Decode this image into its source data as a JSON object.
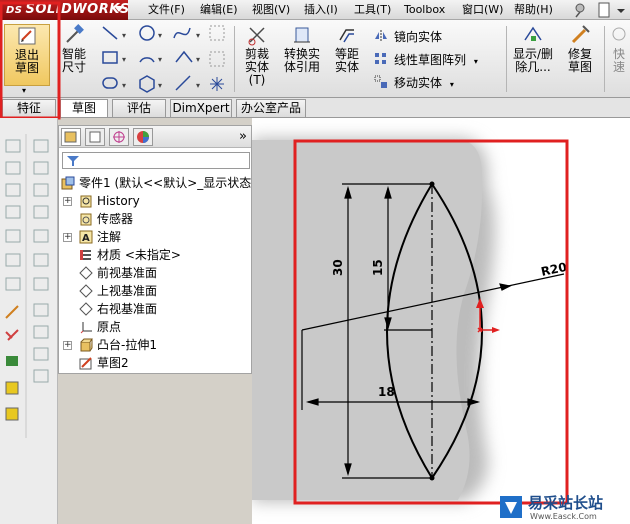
{
  "app": {
    "logo": "SOLIDWORKS",
    "logo_prefix": "DS"
  },
  "menu": [
    "文件(F)",
    "编辑(E)",
    "视图(V)",
    "插入(I)",
    "工具(T)",
    "Toolbox",
    "窗口(W)",
    "帮助(H)"
  ],
  "commands": {
    "exit_sketch": "退出草图",
    "smart_dimension": "智能尺寸",
    "trim": "剪裁实体",
    "trim_suffix": "(T)",
    "convert": "转换实体引用",
    "offset": "等距实体",
    "mirror": "镜向实体",
    "linear_pattern": "线性草图阵列",
    "move": "移动实体",
    "display_delete": "显示/删除几...",
    "repair": "修复草图",
    "quick": "快速"
  },
  "tabs": [
    "特征",
    "草图",
    "评估",
    "DimXpert",
    "办公室产品"
  ],
  "active_tab": "草图",
  "feature_tree": {
    "root": "零件1 (默认<<默认>_显示状态",
    "items": [
      {
        "label": "History",
        "expandable": true
      },
      {
        "label": "传感器",
        "expandable": false
      },
      {
        "label": "注解",
        "expandable": true
      },
      {
        "label": "材质 <未指定>",
        "expandable": false
      },
      {
        "label": "前视基准面",
        "expandable": false
      },
      {
        "label": "上视基准面",
        "expandable": false
      },
      {
        "label": "右视基准面",
        "expandable": false
      },
      {
        "label": "原点",
        "expandable": false
      },
      {
        "label": "凸台-拉伸1",
        "expandable": true
      },
      {
        "label": "草图2",
        "expandable": false
      }
    ]
  },
  "dimensions": {
    "d30": "30",
    "d15": "15",
    "d18": "18",
    "r20": "R20"
  },
  "watermark": {
    "brand": "易采站长站",
    "url": "Www.Easck.Com"
  },
  "colors": {
    "highlight": "#e02020",
    "accent": "#c42020"
  }
}
